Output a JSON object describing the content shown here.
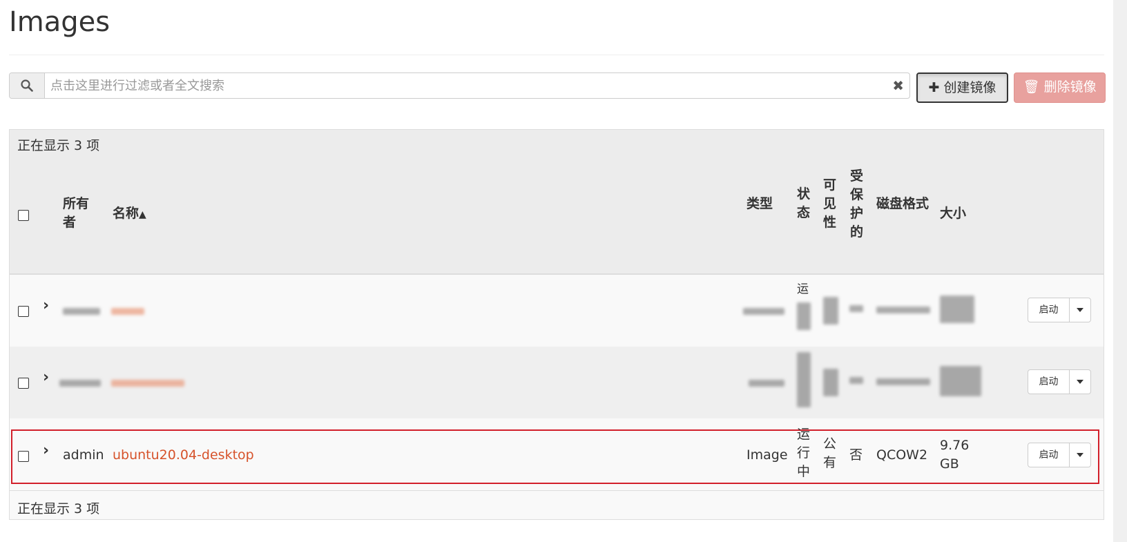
{
  "page": {
    "title": "Images"
  },
  "search": {
    "placeholder": "点击这里进行过滤或者全文搜索",
    "clear_icon": "times-icon"
  },
  "toolbar": {
    "create_label": "创建镜像",
    "create_icon": "plus-icon",
    "delete_label": "删除镜像",
    "delete_icon": "trash-icon"
  },
  "table": {
    "showing_text_top": "正在显示 3 项",
    "showing_text_bottom": "正在显示 3 项",
    "headers": {
      "owner": "所有者",
      "name": "名称",
      "type": "类型",
      "status": "状态",
      "visibility": "可见性",
      "protected": "受保护的",
      "disk_format": "磁盘格式",
      "size": "大小"
    },
    "rows": [
      {
        "owner": "",
        "name": "",
        "type": "",
        "status": "运",
        "visibility": "",
        "protected": "",
        "disk_format": "",
        "size": "",
        "blurred": true
      },
      {
        "owner": "",
        "name": "",
        "type": "",
        "status": "",
        "visibility": "",
        "protected": "",
        "disk_format": "",
        "size": "",
        "blurred": true
      },
      {
        "owner": "admin",
        "name": "ubuntu20.04-desktop",
        "type": "Image",
        "status": "运行中",
        "visibility": "公有",
        "protected": "否",
        "disk_format": "QCOW2",
        "size": "9.76 GB",
        "blurred": false
      }
    ],
    "action_label": "启动"
  },
  "colors": {
    "link": "#d6522a",
    "highlight_outline": "#d21f2a",
    "danger_button": "#e8a19e"
  }
}
